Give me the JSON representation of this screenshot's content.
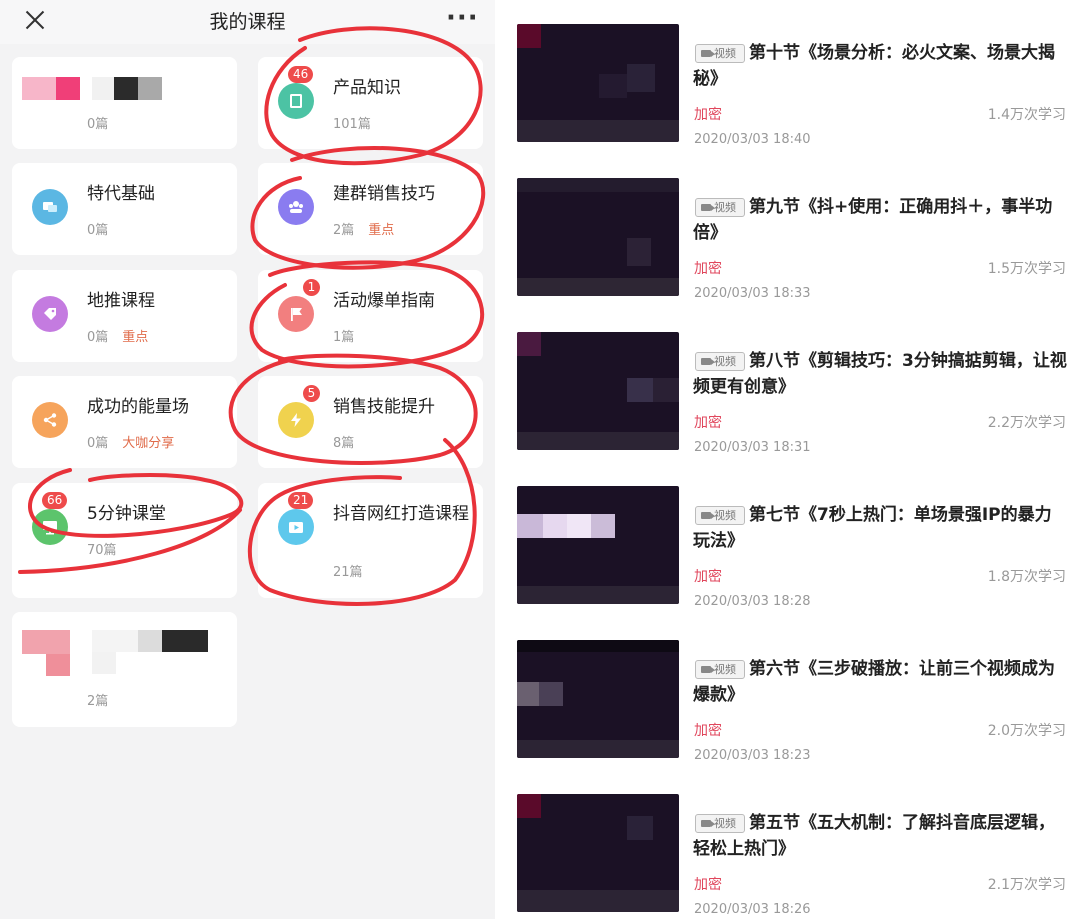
{
  "header": {
    "title": "我的课程"
  },
  "courses": [
    {
      "name": "",
      "count": "0篇",
      "tag": "",
      "badge": ""
    },
    {
      "name": "产品知识",
      "count": "101篇",
      "tag": "",
      "badge": "46"
    },
    {
      "name": "特代基础",
      "count": "0篇",
      "tag": "",
      "badge": ""
    },
    {
      "name": "建群销售技巧",
      "count": "2篇",
      "tag": "重点",
      "badge": ""
    },
    {
      "name": "地推课程",
      "count": "0篇",
      "tag": "重点",
      "badge": ""
    },
    {
      "name": "活动爆单指南",
      "count": "1篇",
      "tag": "",
      "badge": "1"
    },
    {
      "name": "成功的能量场",
      "count": "0篇",
      "tag": "大咖分享",
      "badge": ""
    },
    {
      "name": "销售技能提升",
      "count": "8篇",
      "tag": "",
      "badge": "5"
    },
    {
      "name": "5分钟课堂",
      "count": "70篇",
      "tag": "",
      "badge": "66"
    },
    {
      "name": "抖音网红打造课程",
      "count": "21篇",
      "tag": "",
      "badge": "21"
    },
    {
      "name": "",
      "count": "2篇",
      "tag": "",
      "badge": ""
    }
  ],
  "lessons": [
    {
      "type": "视频",
      "title": "第十节《场景分析：必火文案、场景大揭秘》",
      "lock": "加密",
      "views": "1.4万次学习",
      "date": "2020/03/03 18:40"
    },
    {
      "type": "视频",
      "title": "第九节《抖+使用：正确用抖＋，事半功倍》",
      "lock": "加密",
      "views": "1.5万次学习",
      "date": "2020/03/03 18:33"
    },
    {
      "type": "视频",
      "title": "第八节《剪辑技巧：3分钟搞掂剪辑，让视频更有创意》",
      "lock": "加密",
      "views": "2.2万次学习",
      "date": "2020/03/03 18:31"
    },
    {
      "type": "视频",
      "title": "第七节《7秒上热门：单场景强IP的暴力玩法》",
      "lock": "加密",
      "views": "1.8万次学习",
      "date": "2020/03/03 18:28"
    },
    {
      "type": "视频",
      "title": "第六节《三步破播放：让前三个视频成为爆款》",
      "lock": "加密",
      "views": "2.0万次学习",
      "date": "2020/03/03 18:23"
    },
    {
      "type": "视频",
      "title": "第五节《五大机制：了解抖音底层逻辑，轻松上热门》",
      "lock": "加密",
      "views": "2.1万次学习",
      "date": "2020/03/03 18:26"
    }
  ],
  "colors": {
    "badge": "#ee4b4b",
    "tag": "#e06b4a",
    "lock": "#e0465c",
    "annotation": "#e8323a",
    "icon_book": "#4cc3a4",
    "icon_chat": "#5bb7e3",
    "icon_group": "#8a7cf0",
    "icon_tag": "#c47be0",
    "icon_flag": "#f27f7f",
    "icon_share": "#f6a45c",
    "icon_bolt": "#f0d24e",
    "icon_board": "#5cc46c",
    "icon_play": "#5ec8ec"
  },
  "icons": [
    "close-icon",
    "more-icon",
    "book-icon",
    "chat-icon",
    "group-icon",
    "tag-icon",
    "flag-icon",
    "share-icon",
    "bolt-icon",
    "board-icon",
    "play-icon",
    "video-camera-icon"
  ]
}
